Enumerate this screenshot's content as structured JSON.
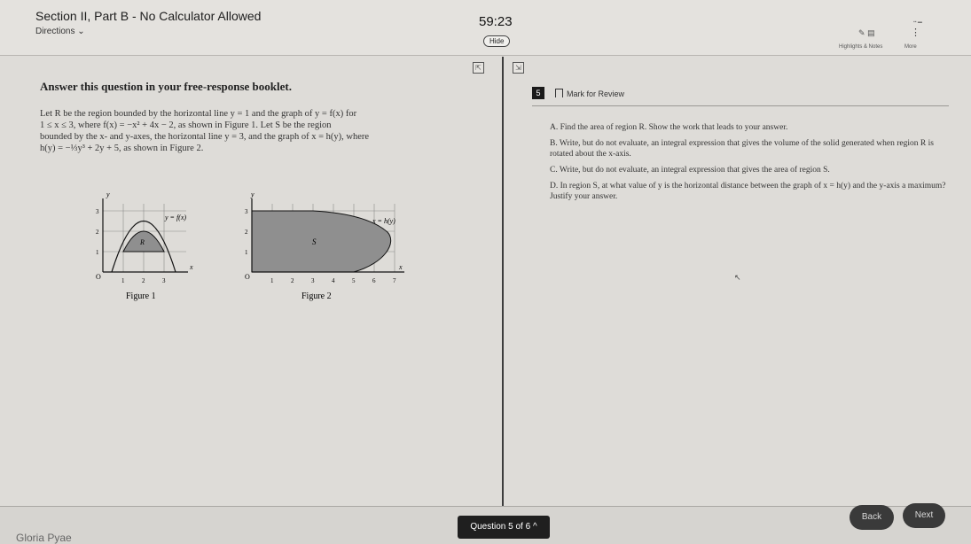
{
  "header": {
    "section_title": "Section II, Part B - No Calculator Allowed",
    "directions_label": "Directions",
    "timer": "59:23",
    "hide_label": "Hide",
    "highlights_label": "Highlights & Notes",
    "more_label": "More"
  },
  "left": {
    "prompt": "Answer this question in your free-response booklet.",
    "stem_line1": "Let R be the region bounded by the horizontal line y = 1 and the graph of y = f(x) for",
    "stem_line2": "1 ≤ x ≤ 3, where f(x) = −x² + 4x − 2, as shown in Figure 1. Let S be the region",
    "stem_line3": "bounded by the x- and y-axes, the horizontal line y = 3, and the graph of x = h(y), where",
    "stem_line4": "h(y) = −⅓y³ + 2y + 5, as shown in Figure 2.",
    "figure1": {
      "caption": "Figure 1",
      "curve_label": "y = f(x)",
      "region_label": "R",
      "x_label": "x",
      "y_label": "y",
      "origin": "O",
      "x_ticks": [
        "1",
        "2",
        "3"
      ],
      "y_ticks": [
        "1",
        "2",
        "3"
      ]
    },
    "figure2": {
      "caption": "Figure 2",
      "curve_label": "x = h(y)",
      "region_label": "S",
      "x_label": "x",
      "y_label": "y",
      "origin": "O",
      "x_ticks": [
        "1",
        "2",
        "3",
        "4",
        "5",
        "6",
        "7"
      ],
      "y_ticks": [
        "1",
        "2",
        "3"
      ]
    }
  },
  "question": {
    "number": "5",
    "mark_for_review": "Mark for Review",
    "parts": [
      "A. Find the area of region R. Show the work that leads to your answer.",
      "B. Write, but do not evaluate, an integral expression that gives the volume of the solid generated when region R is rotated about the x-axis.",
      "C. Write, but do not evaluate, an integral expression that gives the area of region S.",
      "D. In region S, at what value of y is the horizontal distance between the graph of x = h(y) and the y-axis a maximum? Justify your answer."
    ]
  },
  "footer": {
    "user_name": "Gloria Pyae",
    "question_nav": "Question 5 of 6",
    "back_label": "Back",
    "next_label": "Next"
  }
}
